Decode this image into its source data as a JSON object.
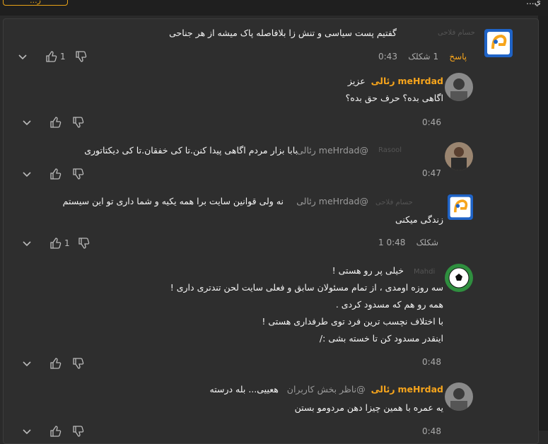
{
  "topbar": {
    "button_label": "...ر",
    "title": "...ي"
  },
  "comments": [
    {
      "faded_name": "حسام فلاحی",
      "text": "گفتیم پست سیاسی و تنش زا بلافاصله پاک میشه از هر جناحی",
      "time": "0:43",
      "likes_label": "1 شکلک",
      "reply_label": "پاسخ",
      "like_count": "1"
    },
    {
      "name": "meHrdad",
      "name_suffix": "رئالی",
      "line1_rest": "عزیز",
      "line2": "اگاهی بده؟ حرف حق بده؟",
      "time": "0:46"
    },
    {
      "faded_name": "Rasool",
      "mention": "@meHrdad رئالی",
      "text": "بابا بزار مردم اگاهی پیدا کنن.تا کی خفقان.تا کی دیکتاتوری",
      "time": "0:47"
    },
    {
      "faded_name": "حسام فلاحی",
      "mention": "@meHrdad رئالی",
      "line1": "نه ولی قوانین سایت برا همه یکیه و شما داری تو این سیستم",
      "line2": "زندگی میکنی",
      "time": "0:48",
      "likes_label": "1 شکلک",
      "like_count": "1"
    },
    {
      "faded_name": "Mahdi",
      "lines": [
        "خیلی پر رو هستی !",
        "سه روزه اومدی ، از تمام مسئولان سابق و فعلی سایت لحن تندتری داری !",
        "همه رو هم که مسدود کردی .",
        "با اختلاف نچسب ترین فرد توی طرفداری هستی !",
        "اینقدر مسدود کن تا خسته بشی :/"
      ],
      "time": "0:48"
    },
    {
      "name": "meHrdad",
      "name_suffix": "رئالی",
      "mention": "@ناظر بخش کاربران",
      "line1_rest": "هعییی... بله درسته",
      "line2": "یه عمره با همین چیزا دهن مردومو بستن",
      "time": "0:48"
    }
  ],
  "colors": {
    "accent": "#f7a51c",
    "background": "#2e2e2e",
    "muted": "#aaaaaa"
  }
}
